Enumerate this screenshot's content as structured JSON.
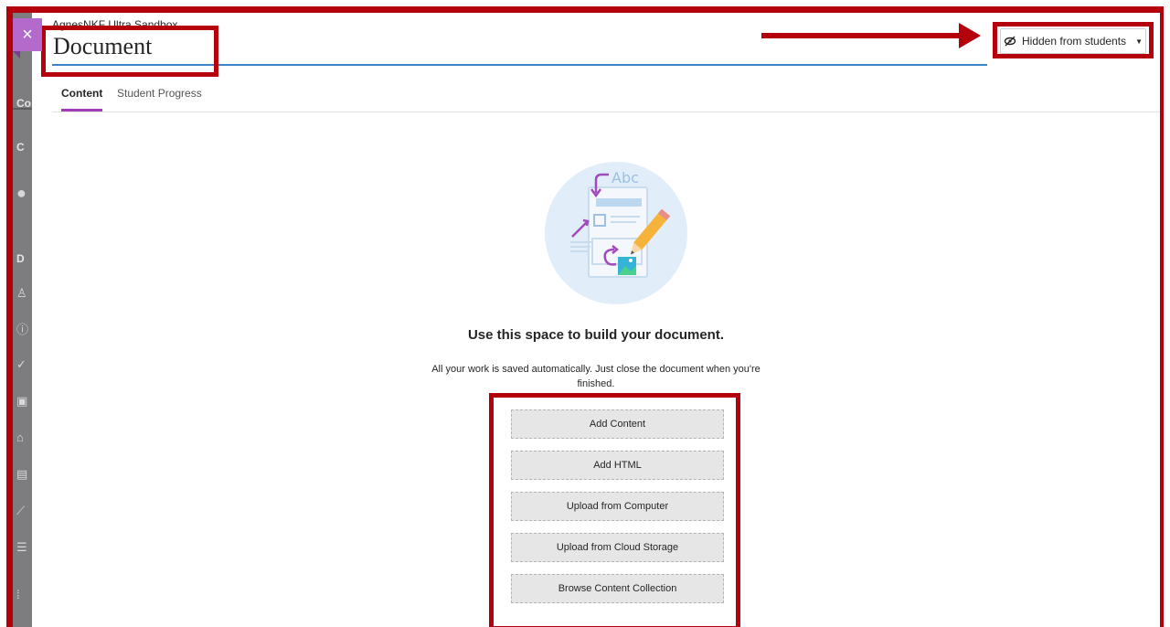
{
  "app": {
    "course_name": "AgnesNKF Ultra Sandbox",
    "document_title": "Document",
    "close_label": "×"
  },
  "visibility": {
    "label": "Hidden from students",
    "icon": "eye-slash-icon"
  },
  "tabs": [
    {
      "label": "Content",
      "active": true
    },
    {
      "label": "Student Progress",
      "active": false
    }
  ],
  "empty_state": {
    "illustration_text": "Abc",
    "heading": "Use this space to build your document.",
    "description_line1": "All your work is saved automatically. Just close the document when you're",
    "description_line2": "finished."
  },
  "actions": [
    {
      "label": "Add Content"
    },
    {
      "label": "Add HTML"
    },
    {
      "label": "Upload from Computer"
    },
    {
      "label": "Upload from Cloud Storage"
    },
    {
      "label": "Browse Content Collection"
    }
  ],
  "colors": {
    "highlight": "#b3000c",
    "accent_purple": "#a13cb7",
    "title_underline": "#3b83c9"
  }
}
